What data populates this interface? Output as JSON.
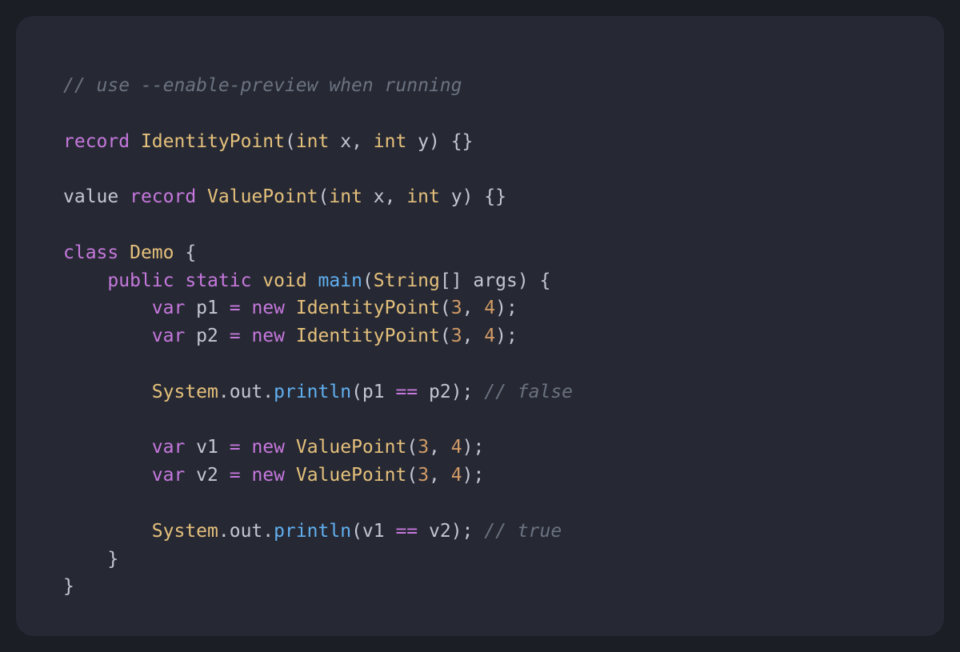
{
  "colors": {
    "background": "#1c1e26",
    "card": "#262934",
    "keyword": "#c678dd",
    "type": "#e5c07b",
    "function": "#61afef",
    "number": "#d19a66",
    "comment": "#6b7280",
    "text": "#c3c7d1"
  },
  "code": {
    "language": "java",
    "lines": [
      [
        {
          "t": "// use --enable-preview when running",
          "k": "cm"
        }
      ],
      [],
      [
        {
          "t": "record",
          "k": "kw"
        },
        {
          "t": " ",
          "k": "tx"
        },
        {
          "t": "IdentityPoint",
          "k": "ty"
        },
        {
          "t": "(",
          "k": "tx"
        },
        {
          "t": "int",
          "k": "ty"
        },
        {
          "t": " x, ",
          "k": "tx"
        },
        {
          "t": "int",
          "k": "ty"
        },
        {
          "t": " y) {}",
          "k": "tx"
        }
      ],
      [],
      [
        {
          "t": "value ",
          "k": "tx"
        },
        {
          "t": "record",
          "k": "kw"
        },
        {
          "t": " ",
          "k": "tx"
        },
        {
          "t": "ValuePoint",
          "k": "ty"
        },
        {
          "t": "(",
          "k": "tx"
        },
        {
          "t": "int",
          "k": "ty"
        },
        {
          "t": " x, ",
          "k": "tx"
        },
        {
          "t": "int",
          "k": "ty"
        },
        {
          "t": " y) {}",
          "k": "tx"
        }
      ],
      [],
      [
        {
          "t": "class",
          "k": "kw"
        },
        {
          "t": " ",
          "k": "tx"
        },
        {
          "t": "Demo",
          "k": "ty"
        },
        {
          "t": " {",
          "k": "tx"
        }
      ],
      [
        {
          "t": "    ",
          "k": "tx"
        },
        {
          "t": "public",
          "k": "kw"
        },
        {
          "t": " ",
          "k": "tx"
        },
        {
          "t": "static",
          "k": "kw"
        },
        {
          "t": " ",
          "k": "tx"
        },
        {
          "t": "void",
          "k": "ty"
        },
        {
          "t": " ",
          "k": "tx"
        },
        {
          "t": "main",
          "k": "fn"
        },
        {
          "t": "(",
          "k": "tx"
        },
        {
          "t": "String",
          "k": "ty"
        },
        {
          "t": "[] args) {",
          "k": "tx"
        }
      ],
      [
        {
          "t": "        ",
          "k": "tx"
        },
        {
          "t": "var",
          "k": "kw"
        },
        {
          "t": " p1 ",
          "k": "tx"
        },
        {
          "t": "=",
          "k": "op"
        },
        {
          "t": " ",
          "k": "tx"
        },
        {
          "t": "new",
          "k": "kw"
        },
        {
          "t": " ",
          "k": "tx"
        },
        {
          "t": "IdentityPoint",
          "k": "ty"
        },
        {
          "t": "(",
          "k": "tx"
        },
        {
          "t": "3",
          "k": "num"
        },
        {
          "t": ", ",
          "k": "tx"
        },
        {
          "t": "4",
          "k": "num"
        },
        {
          "t": ");",
          "k": "tx"
        }
      ],
      [
        {
          "t": "        ",
          "k": "tx"
        },
        {
          "t": "var",
          "k": "kw"
        },
        {
          "t": " p2 ",
          "k": "tx"
        },
        {
          "t": "=",
          "k": "op"
        },
        {
          "t": " ",
          "k": "tx"
        },
        {
          "t": "new",
          "k": "kw"
        },
        {
          "t": " ",
          "k": "tx"
        },
        {
          "t": "IdentityPoint",
          "k": "ty"
        },
        {
          "t": "(",
          "k": "tx"
        },
        {
          "t": "3",
          "k": "num"
        },
        {
          "t": ", ",
          "k": "tx"
        },
        {
          "t": "4",
          "k": "num"
        },
        {
          "t": ");",
          "k": "tx"
        }
      ],
      [],
      [
        {
          "t": "        ",
          "k": "tx"
        },
        {
          "t": "System",
          "k": "ty"
        },
        {
          "t": ".out.",
          "k": "tx"
        },
        {
          "t": "println",
          "k": "fn"
        },
        {
          "t": "(p1 ",
          "k": "tx"
        },
        {
          "t": "==",
          "k": "op"
        },
        {
          "t": " p2); ",
          "k": "tx"
        },
        {
          "t": "// false",
          "k": "cm"
        }
      ],
      [],
      [
        {
          "t": "        ",
          "k": "tx"
        },
        {
          "t": "var",
          "k": "kw"
        },
        {
          "t": " v1 ",
          "k": "tx"
        },
        {
          "t": "=",
          "k": "op"
        },
        {
          "t": " ",
          "k": "tx"
        },
        {
          "t": "new",
          "k": "kw"
        },
        {
          "t": " ",
          "k": "tx"
        },
        {
          "t": "ValuePoint",
          "k": "ty"
        },
        {
          "t": "(",
          "k": "tx"
        },
        {
          "t": "3",
          "k": "num"
        },
        {
          "t": ", ",
          "k": "tx"
        },
        {
          "t": "4",
          "k": "num"
        },
        {
          "t": ");",
          "k": "tx"
        }
      ],
      [
        {
          "t": "        ",
          "k": "tx"
        },
        {
          "t": "var",
          "k": "kw"
        },
        {
          "t": " v2 ",
          "k": "tx"
        },
        {
          "t": "=",
          "k": "op"
        },
        {
          "t": " ",
          "k": "tx"
        },
        {
          "t": "new",
          "k": "kw"
        },
        {
          "t": " ",
          "k": "tx"
        },
        {
          "t": "ValuePoint",
          "k": "ty"
        },
        {
          "t": "(",
          "k": "tx"
        },
        {
          "t": "3",
          "k": "num"
        },
        {
          "t": ", ",
          "k": "tx"
        },
        {
          "t": "4",
          "k": "num"
        },
        {
          "t": ");",
          "k": "tx"
        }
      ],
      [],
      [
        {
          "t": "        ",
          "k": "tx"
        },
        {
          "t": "System",
          "k": "ty"
        },
        {
          "t": ".out.",
          "k": "tx"
        },
        {
          "t": "println",
          "k": "fn"
        },
        {
          "t": "(v1 ",
          "k": "tx"
        },
        {
          "t": "==",
          "k": "op"
        },
        {
          "t": " v2); ",
          "k": "tx"
        },
        {
          "t": "// true",
          "k": "cm"
        }
      ],
      [
        {
          "t": "    }",
          "k": "tx"
        }
      ],
      [
        {
          "t": "}",
          "k": "tx"
        }
      ]
    ]
  }
}
